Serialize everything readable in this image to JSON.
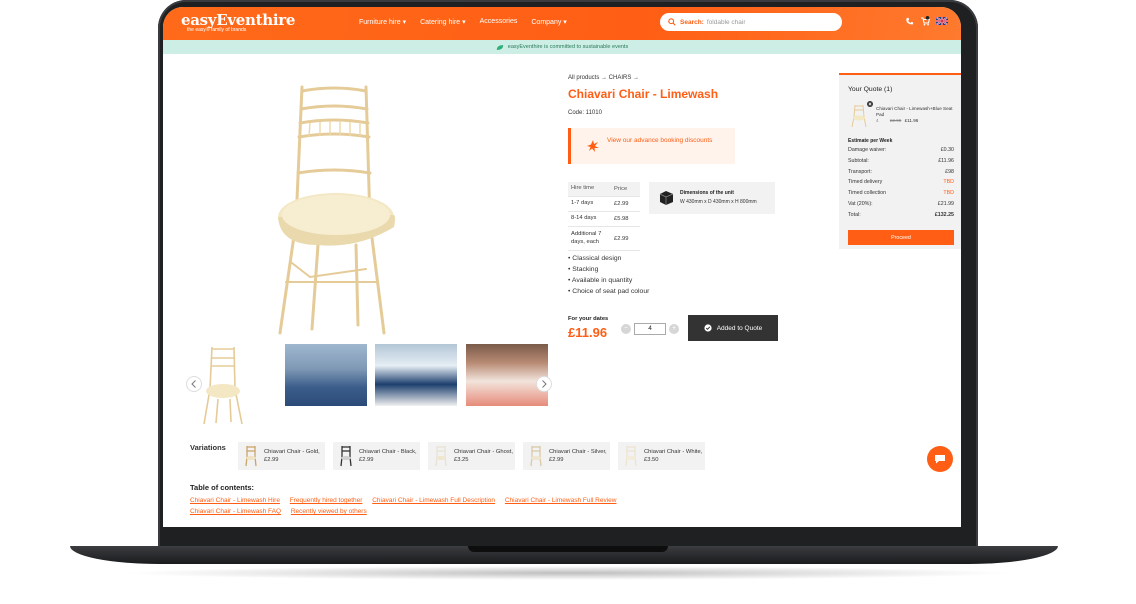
{
  "header": {
    "logo": "easyEventhire",
    "logo_sub": "the easy® family of brands",
    "nav": [
      "Furniture hire ▾",
      "Catering hire ▾",
      "Accessories",
      "Company ▾"
    ],
    "search_label": "Search:",
    "search_placeholder": "foldable chair"
  },
  "eco_banner": "easyEventhire is committed to sustainable events",
  "product": {
    "breadcrumb": "All products → CHAIRS →",
    "title": "Chiavari Chair - Limewash",
    "code": "Code: 11010",
    "promo": "View our advance booking discounts",
    "price_table": {
      "headers": [
        "Hire time",
        "Price"
      ],
      "rows": [
        {
          "label": "1-7 days",
          "price": "£2.99"
        },
        {
          "label": "8-14 days",
          "price": "£5.98"
        },
        {
          "label": "Additional 7 days, each",
          "price": "£2.99"
        }
      ]
    },
    "dimensions_title": "Dimensions of the unit",
    "dimensions": "W 430mm x D 430mm x H 800mm",
    "features": [
      "Classical design",
      "Stacking",
      "Available in quantity",
      "Choice of seat pad colour"
    ],
    "dates_label": "For your dates",
    "price": "£11.96",
    "quantity": "4",
    "added_button": "Added to Quote"
  },
  "quote": {
    "title": "Your Quote (1)",
    "item_name": "Chiavari Chair - Limewash+Blue Seat Pad",
    "item_qty": "4",
    "item_price_old": "£2.99",
    "item_price": "£11.96",
    "estimate_label": "Estimate per Week",
    "lines": [
      {
        "label": "Damage waiver:",
        "value": "£0.30",
        "highlight": false
      },
      {
        "label": "Subtotal:",
        "value": "£11.96",
        "highlight": false
      },
      {
        "label": "Transport:",
        "value": "£98",
        "highlight": false
      },
      {
        "label": "Timed delivery",
        "value": "TBD",
        "highlight": true
      },
      {
        "label": "Timed collection",
        "value": "TBD",
        "highlight": true
      },
      {
        "label": "Vat (20%):",
        "value": "£21.99",
        "highlight": false
      },
      {
        "label": "Total:",
        "value": "£132.25",
        "highlight": false
      }
    ],
    "proceed": "Proceed"
  },
  "variations": {
    "label": "Variations",
    "items": [
      {
        "name": "Chiavari Chair - Gold, £2.99",
        "color": "#c9a46b"
      },
      {
        "name": "Chiavari Chair - Black, £2.99",
        "color": "#333333"
      },
      {
        "name": "Chiavari Chair - Ghost, £3.25",
        "color": "#e8e2d4"
      },
      {
        "name": "Chiavari Chair - Silver, £2.99",
        "color": "#d9c9a8"
      },
      {
        "name": "Chiavari Chair - White, £3.50",
        "color": "#ece4cf"
      }
    ]
  },
  "toc": {
    "title": "Table of contents:",
    "links": [
      "Chiavari Chair - Limewash Hire",
      "Frequently hired together",
      "Chiavari Chair - Limewash Full Description",
      "Chiavari Chair - Limewash Full Review",
      "Chiavari Chair - Limewash FAQ",
      "Recently viewed by others"
    ]
  },
  "colors": {
    "accent": "#ff5e14",
    "eco": "#cdeee4",
    "dark_button": "#333333"
  }
}
